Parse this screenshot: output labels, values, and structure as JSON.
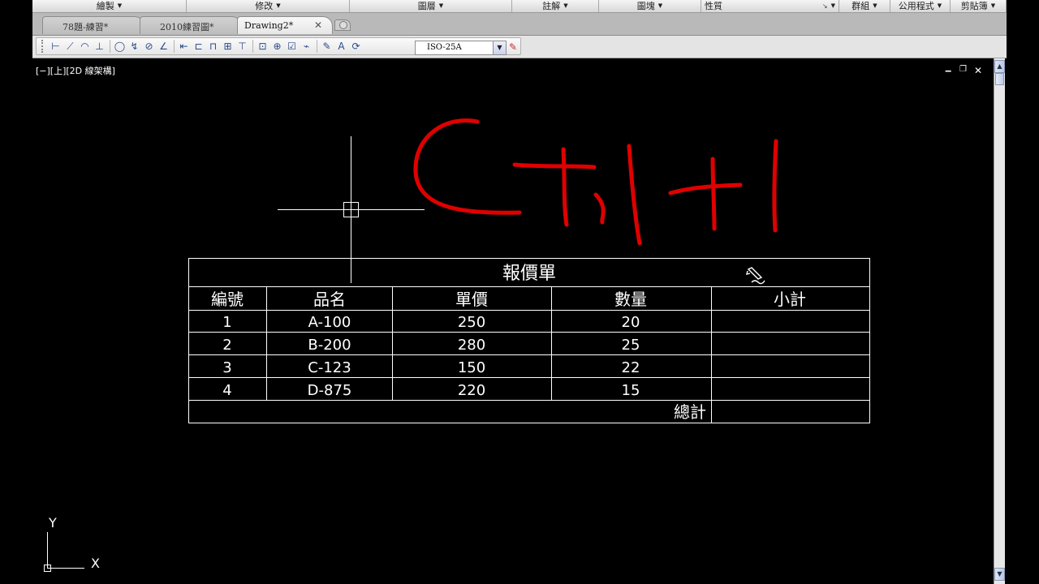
{
  "ribbon": {
    "panels": [
      {
        "label": "繪製",
        "width": 190
      },
      {
        "label": "修改",
        "width": 201
      },
      {
        "label": "圖層",
        "width": 200
      },
      {
        "label": "註解",
        "width": 107
      },
      {
        "label": "圖塊",
        "width": 126
      },
      {
        "label": "性質",
        "width": 170
      },
      {
        "label": "群組",
        "width": 63
      },
      {
        "label": "公用程式",
        "width": 74
      },
      {
        "label": "剪貼簿",
        "width": 69
      }
    ]
  },
  "tabs": [
    {
      "label": "78題-練習*",
      "active": false
    },
    {
      "label": "2010練習圖*",
      "active": false
    },
    {
      "label": "Drawing2*",
      "active": true
    }
  ],
  "toolbar": {
    "dimstyle_value": "ISO-25A"
  },
  "viewport": {
    "label": "[−][上][2D 線架構]"
  },
  "table": {
    "title": "報價單",
    "headers": [
      "編號",
      "品名",
      "單價",
      "數量",
      "小計"
    ],
    "rows": [
      [
        "1",
        "A-100",
        "250",
        "20",
        ""
      ],
      [
        "2",
        "B-200",
        "280",
        "25",
        ""
      ],
      [
        "3",
        "C-123",
        "150",
        "22",
        ""
      ],
      [
        "4",
        "D-875",
        "220",
        "15",
        ""
      ]
    ],
    "total_label": "總計"
  },
  "annotation": {
    "text": "Ctrl+1",
    "color": "#e00000"
  },
  "ucs": {
    "x_label": "X",
    "y_label": "Y"
  },
  "colors": {
    "canvas": "#000000",
    "linework": "#ffffff",
    "ink": "#e00000"
  }
}
